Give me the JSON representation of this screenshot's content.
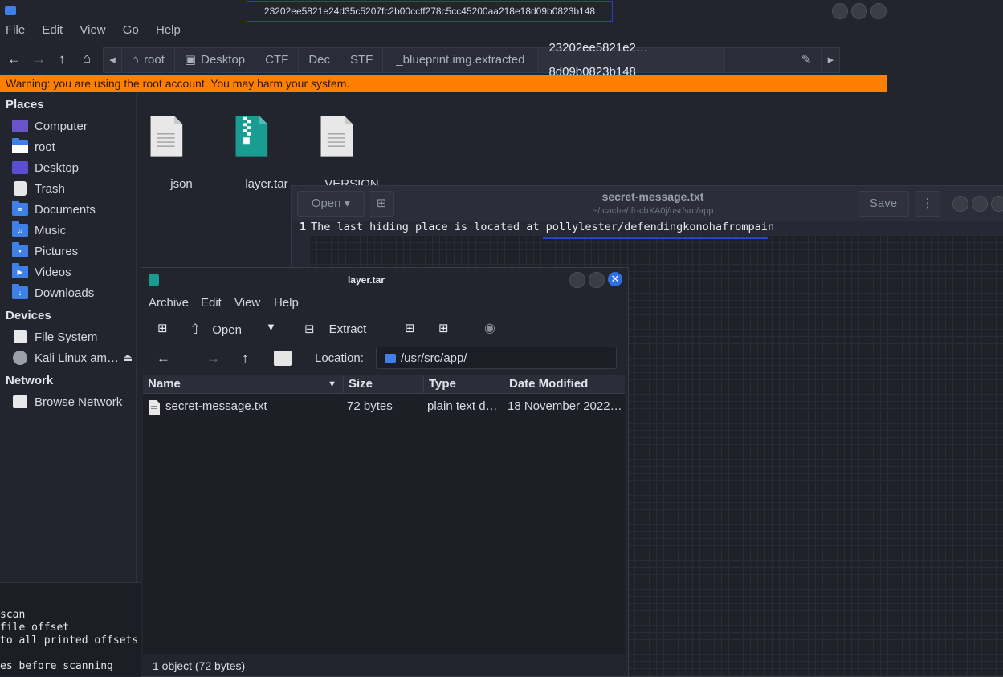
{
  "file_manager": {
    "window_title": "23202ee5821e24d35c5207fc2b00ccff278c5cc45200aa218e18d09b0823b148",
    "menu": [
      "File",
      "Edit",
      "View",
      "Go",
      "Help"
    ],
    "breadcrumbs": [
      "root",
      "Desktop",
      "CTF",
      "Dec",
      "STF",
      "_blueprint.img.extracted",
      "23202ee5821e2…8d09b0823b148"
    ],
    "warning": "Warning: you are using the root account. You may harm your system.",
    "sidebar": {
      "places_heading": "Places",
      "places": [
        "Computer",
        "root",
        "Desktop",
        "Trash",
        "Documents",
        "Music",
        "Pictures",
        "Videos",
        "Downloads"
      ],
      "devices_heading": "Devices",
      "devices": [
        "File System",
        "Kali Linux am…"
      ],
      "network_heading": "Network",
      "network": [
        "Browse Network"
      ]
    },
    "files": [
      "json",
      "layer.tar",
      "VERSION"
    ]
  },
  "terminal": {
    "lines": [
      "scan",
      "file offset",
      "to all printed offsets",
      "",
      "es before scanning"
    ]
  },
  "editor": {
    "open_label": "Open",
    "title": "secret-message.txt",
    "subtitle": "~/.cache/.fr-cbXA0j/usr/src/app",
    "save_label": "Save",
    "line_number": "1",
    "line_text": "The last hiding place is located at pollylester/defendingkonohafrompain"
  },
  "archive": {
    "title": "layer.tar",
    "menu": [
      "Archive",
      "Edit",
      "View",
      "Help"
    ],
    "open_label": "Open",
    "extract_label": "Extract",
    "location_label": "Location:",
    "location_value": "/usr/src/app/",
    "columns": [
      "Name",
      "Size",
      "Type",
      "Date Modified"
    ],
    "rows": [
      {
        "name": "secret-message.txt",
        "size": "72 bytes",
        "type": "plain text d…",
        "date": "18 November 2022…"
      }
    ],
    "status": "1 object (72 bytes)"
  },
  "colors": {
    "warning_bg": "#ff7f00",
    "folder_blue": "#3f80e8",
    "archive_teal": "#1a9c93",
    "window_bg": "#23252e"
  }
}
